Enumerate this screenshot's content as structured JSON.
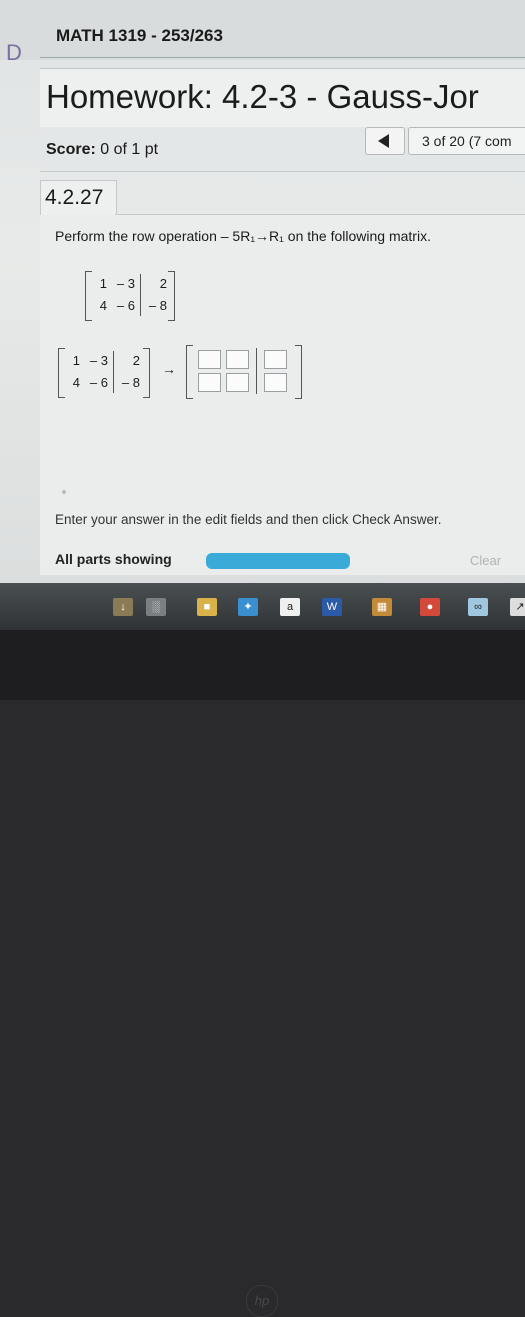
{
  "header": {
    "course_title": "MATH 1319 - 253/263",
    "side_letter": "D"
  },
  "homework": {
    "title": "Homework: 4.2-3 - Gauss-Jor"
  },
  "score": {
    "label": "Score:",
    "value": "0 of 1 pt"
  },
  "navigation": {
    "counter": "3 of 20 (7 com"
  },
  "problem": {
    "section": "4.2.27",
    "instruction_prefix": "Perform the row operation",
    "row_operation": "– 5R₁→R₁",
    "instruction_suffix": "on the following matrix.",
    "matrix": [
      [
        "1",
        "– 3",
        "2"
      ],
      [
        "4",
        "– 6",
        "– 8"
      ]
    ],
    "arrow": "→",
    "enter_prompt": "Enter your answer in the edit fields and then click Check Answer.",
    "parts_label": "All parts showing",
    "progress": 1.0,
    "clear_label": "Clear"
  },
  "taskbar": {
    "icons": [
      {
        "name": "usb-icon",
        "glyph": "↓",
        "color": "#8a7a55"
      },
      {
        "name": "window-icon",
        "glyph": "░",
        "color": "#7a7f83"
      },
      {
        "name": "folder-icon",
        "glyph": "■",
        "color": "#d9b24a"
      },
      {
        "name": "store-icon",
        "glyph": "✦",
        "color": "#3a8fd0"
      },
      {
        "name": "amazon-icon",
        "glyph": "a",
        "color": "#f0f0f0"
      },
      {
        "name": "word-icon",
        "glyph": "W",
        "color": "#2b5aa8"
      },
      {
        "name": "calendar-icon",
        "glyph": "▦",
        "color": "#c38a3a"
      },
      {
        "name": "chrome-icon",
        "glyph": "●",
        "color": "#d44a3a"
      },
      {
        "name": "infinity-icon",
        "glyph": "∞",
        "color": "#9fc8e0"
      },
      {
        "name": "screenshot-icon",
        "glyph": "↗",
        "color": "#dddddd"
      }
    ]
  },
  "bezel": {
    "logo": "hp"
  }
}
